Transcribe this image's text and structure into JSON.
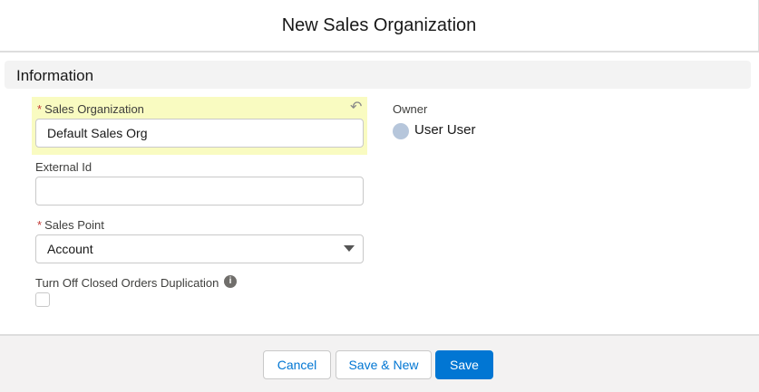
{
  "modal": {
    "title": "New Sales Organization"
  },
  "section": {
    "title": "Information"
  },
  "fields": {
    "sales_org": {
      "label": "Sales Organization",
      "value": "Default Sales Org"
    },
    "external_id": {
      "label": "External Id",
      "value": ""
    },
    "sales_point": {
      "label": "Sales Point",
      "value": "Account"
    },
    "turn_off": {
      "label": "Turn Off Closed Orders Duplication",
      "checked": false
    },
    "owner": {
      "label": "Owner",
      "value": "User User"
    }
  },
  "footer": {
    "cancel": "Cancel",
    "save_new": "Save & New",
    "save": "Save"
  }
}
